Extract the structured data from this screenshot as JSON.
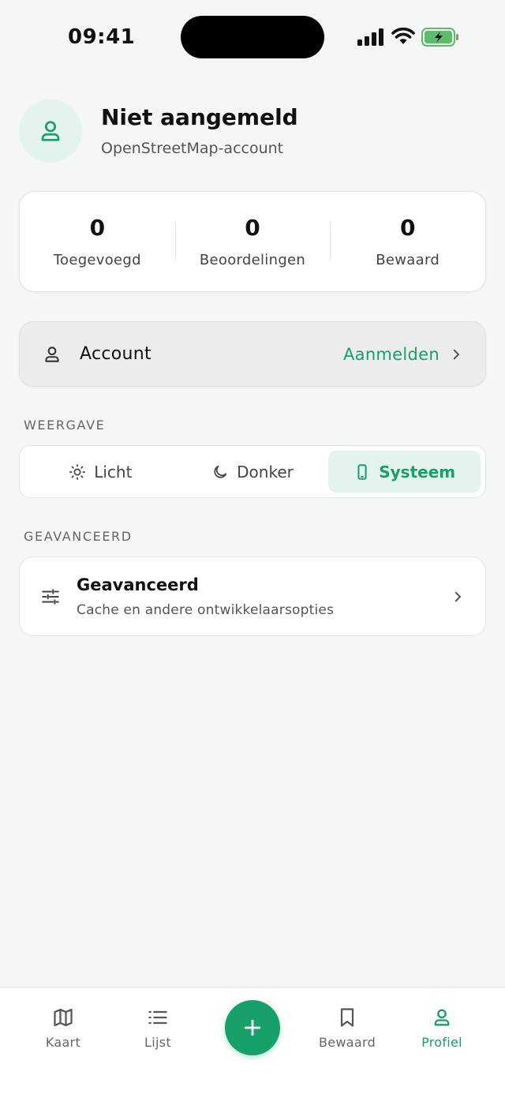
{
  "status_bar": {
    "time": "09:41"
  },
  "profile": {
    "name": "Niet aangemeld",
    "subtitle": "OpenStreetMap-account",
    "avatar_icon": "person-icon"
  },
  "stats": [
    {
      "value": "0",
      "label": "Toegevoegd"
    },
    {
      "value": "0",
      "label": "Beoordelingen"
    },
    {
      "value": "0",
      "label": "Bewaard"
    }
  ],
  "account": {
    "label": "Account",
    "action": "Aanmelden",
    "icon": "person-icon"
  },
  "appearance": {
    "section_title": "WEERGAVE",
    "options": [
      {
        "label": "Licht",
        "icon": "sun-icon"
      },
      {
        "label": "Donker",
        "icon": "moon-icon"
      },
      {
        "label": "Systeem",
        "icon": "phone-icon",
        "selected": true
      }
    ]
  },
  "advanced": {
    "section_title": "GEAVANCEERD",
    "title": "Geavanceerd",
    "subtitle": "Cache en andere ontwikkelaarsopties",
    "icon": "sliders-icon"
  },
  "tabbar": {
    "tabs": [
      {
        "label": "Kaart",
        "icon": "map-icon"
      },
      {
        "label": "Lijst",
        "icon": "list-icon"
      },
      {
        "label": "Bewaard",
        "icon": "bookmark-icon"
      },
      {
        "label": "Profiel",
        "icon": "person-icon",
        "active": true
      }
    ],
    "fab_icon": "plus-icon"
  },
  "colors": {
    "accent": "#17a06a",
    "accent_light": "#e3f4ec",
    "background": "#f5f6f6"
  }
}
